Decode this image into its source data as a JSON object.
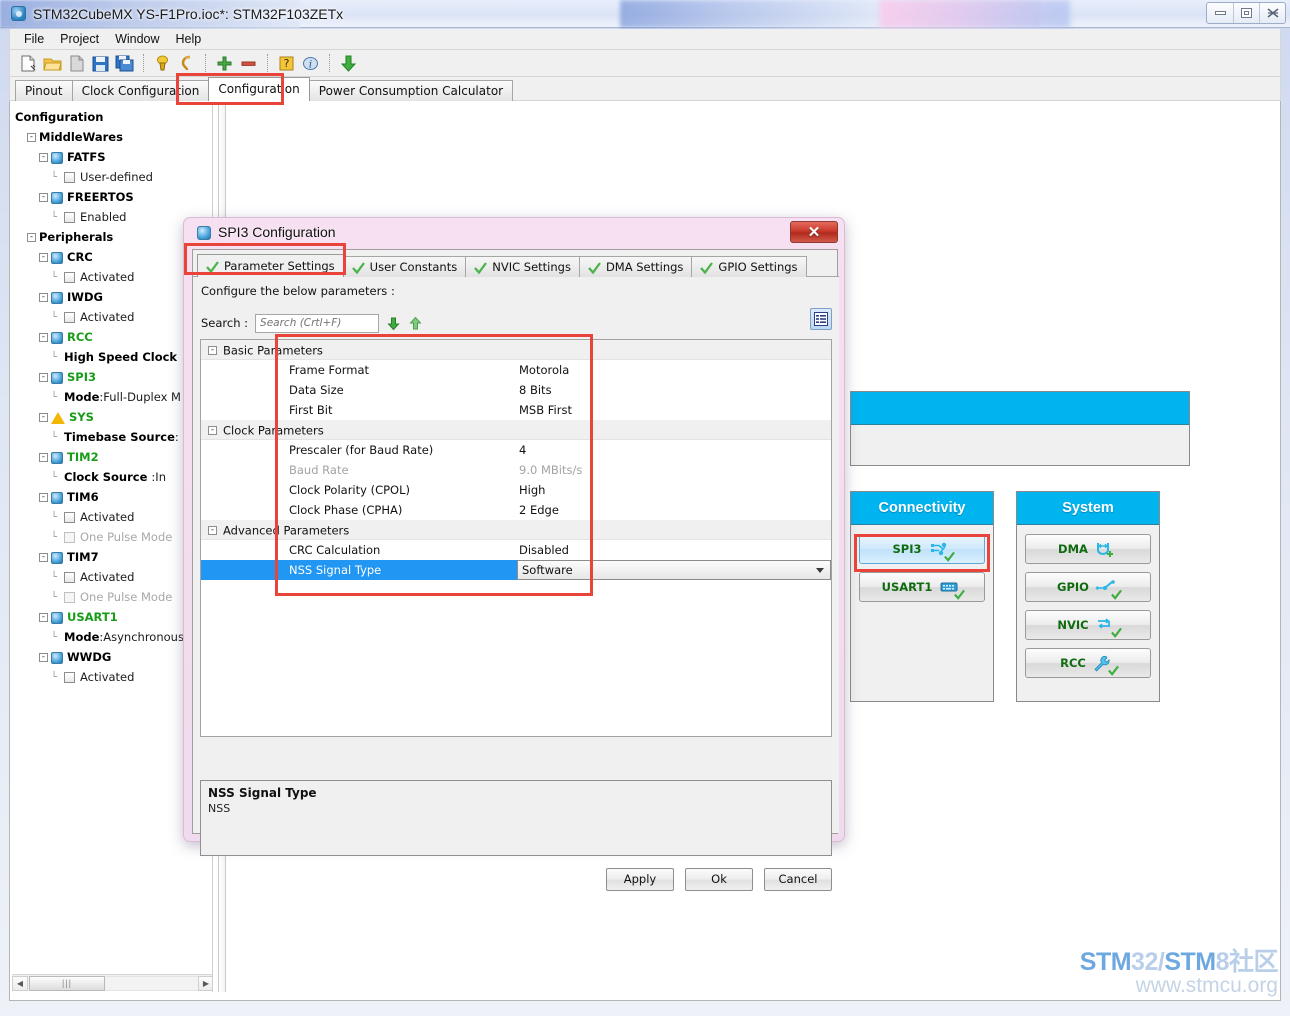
{
  "window": {
    "title": "STM32CubeMX YS-F1Pro.ioc*: STM32F103ZETx",
    "icon": "cubemx-icon",
    "buttons": {
      "minimize": "minimize-icon",
      "maximize": "maximize-icon",
      "close": "close-icon"
    }
  },
  "menubar": {
    "items": [
      "File",
      "Project",
      "Window",
      "Help"
    ]
  },
  "toolbar": {
    "items": [
      {
        "name": "new-project-icon"
      },
      {
        "name": "open-project-icon"
      },
      {
        "name": "save-as-icon"
      },
      {
        "name": "save-icon"
      },
      {
        "name": "save-all-icon"
      },
      {
        "name": "generate-report-icon"
      },
      {
        "name": "generate-code-icon"
      },
      {
        "name": "zoom-in-icon"
      },
      {
        "name": "zoom-out-icon"
      },
      {
        "name": "help-icon"
      },
      {
        "name": "about-icon"
      },
      {
        "name": "download-icon"
      }
    ]
  },
  "tabs": {
    "items": [
      "Pinout",
      "Clock Configuration",
      "Configuration",
      "Power Consumption Calculator"
    ],
    "selected": "Configuration"
  },
  "sidebar": {
    "root_label": "Configuration",
    "nodes": [
      {
        "label": "MiddleWares",
        "type": "group",
        "indent": 1,
        "expander": "-"
      },
      {
        "label": "FATFS",
        "type": "peripheral",
        "indent": 2,
        "expander": "-",
        "state": "normal"
      },
      {
        "label": "User-defined",
        "type": "checkbox",
        "indent": 3,
        "checked": false
      },
      {
        "label": "FREERTOS",
        "type": "peripheral",
        "indent": 2,
        "expander": "-",
        "state": "normal"
      },
      {
        "label": "Enabled",
        "type": "checkbox",
        "indent": 3,
        "checked": false
      },
      {
        "label": "Peripherals",
        "type": "group",
        "indent": 1,
        "expander": "-"
      },
      {
        "label": "CRC",
        "type": "peripheral",
        "indent": 2,
        "expander": "-",
        "state": "normal"
      },
      {
        "label": "Activated",
        "type": "checkbox",
        "indent": 3,
        "checked": false
      },
      {
        "label": "IWDG",
        "type": "peripheral",
        "indent": 2,
        "expander": "-",
        "state": "normal"
      },
      {
        "label": "Activated",
        "type": "checkbox",
        "indent": 3,
        "checked": false
      },
      {
        "label": "RCC",
        "type": "peripheral",
        "indent": 2,
        "expander": "-",
        "state": "active"
      },
      {
        "label": "High Speed Clock",
        "type": "leaf",
        "indent": 3
      },
      {
        "label": "SPI3",
        "type": "peripheral",
        "indent": 2,
        "expander": "-",
        "state": "active"
      },
      {
        "label": "Mode",
        "value": ":Full-Duplex M",
        "type": "kv",
        "indent": 3
      },
      {
        "label": "SYS",
        "type": "peripheral-warn",
        "indent": 2,
        "expander": "-",
        "state": "active"
      },
      {
        "label": "Timebase Source",
        "value": ":",
        "type": "kv",
        "indent": 3
      },
      {
        "label": "TIM2",
        "type": "peripheral",
        "indent": 2,
        "expander": "-",
        "state": "active"
      },
      {
        "label": "Clock Source ",
        "value": ":In",
        "type": "kv",
        "indent": 3
      },
      {
        "label": "TIM6",
        "type": "peripheral",
        "indent": 2,
        "expander": "-",
        "state": "normal"
      },
      {
        "label": "Activated",
        "type": "checkbox",
        "indent": 3,
        "checked": false
      },
      {
        "label": "One Pulse Mode",
        "type": "checkbox",
        "indent": 3,
        "checked": false,
        "disabled": true
      },
      {
        "label": "TIM7",
        "type": "peripheral",
        "indent": 2,
        "expander": "-",
        "state": "normal"
      },
      {
        "label": "Activated",
        "type": "checkbox",
        "indent": 3,
        "checked": false
      },
      {
        "label": "One Pulse Mode",
        "type": "checkbox",
        "indent": 3,
        "checked": false,
        "disabled": true
      },
      {
        "label": "USART1",
        "type": "peripheral",
        "indent": 2,
        "expander": "-",
        "state": "active"
      },
      {
        "label": "Mode",
        "value": ":Asynchronous",
        "type": "kv",
        "indent": 3
      },
      {
        "label": "WWDG",
        "type": "peripheral",
        "indent": 2,
        "expander": "-",
        "state": "normal"
      },
      {
        "label": "Activated",
        "type": "checkbox",
        "indent": 3,
        "checked": false
      }
    ],
    "scrollbar": {
      "left_arrow": "◀",
      "right_arrow": "▶",
      "grip": "|||"
    }
  },
  "canvas": {
    "panels": [
      {
        "title": "Connectivity",
        "buttons": [
          {
            "label": "SPI3",
            "icon": "spi-icon",
            "selected": true,
            "checked": true
          },
          {
            "label": "USART1",
            "icon": "usart-icon",
            "selected": false,
            "checked": true
          }
        ]
      },
      {
        "title": "System",
        "buttons": [
          {
            "label": "DMA",
            "icon": "dma-icon",
            "selected": false,
            "checked": false,
            "plus": true
          },
          {
            "label": "GPIO",
            "icon": "gpio-icon",
            "selected": false,
            "checked": true
          },
          {
            "label": "NVIC",
            "icon": "nvic-icon",
            "selected": false,
            "checked": true
          },
          {
            "label": "RCC",
            "icon": "rcc-wrench-icon",
            "selected": false,
            "checked": true
          }
        ]
      }
    ]
  },
  "dialog": {
    "title": "SPI3 Configuration",
    "icon": "cubemx-icon",
    "close_label": "✕",
    "tabs": [
      {
        "label": "Parameter Settings",
        "selected": true,
        "icon": "green-check-icon"
      },
      {
        "label": "User Constants",
        "selected": false,
        "icon": "green-check-icon"
      },
      {
        "label": "NVIC Settings",
        "selected": false,
        "icon": "green-check-icon"
      },
      {
        "label": "DMA Settings",
        "selected": false,
        "icon": "green-check-icon"
      },
      {
        "label": "GPIO Settings",
        "selected": false,
        "icon": "green-check-icon"
      }
    ],
    "configure_label": "Configure the below parameters :",
    "search": {
      "label": "Search :",
      "placeholder": "Search (Crtl+F)",
      "value": "",
      "next_icon": "arrow-down-icon",
      "prev_icon": "arrow-up-icon"
    },
    "listview_icon": "list-view-icon",
    "table": {
      "rows": [
        {
          "kind": "group",
          "name": "Basic Parameters",
          "expander": "-"
        },
        {
          "kind": "item",
          "name": "Frame Format",
          "value": "Motorola"
        },
        {
          "kind": "item",
          "name": "Data Size",
          "value": "8 Bits"
        },
        {
          "kind": "item",
          "name": "First Bit",
          "value": "MSB First"
        },
        {
          "kind": "group",
          "name": "Clock Parameters",
          "expander": "-"
        },
        {
          "kind": "item",
          "name": "Prescaler (for Baud Rate)",
          "value": "4"
        },
        {
          "kind": "item",
          "name": "Baud Rate",
          "value": "9.0 MBits/s",
          "disabled": true
        },
        {
          "kind": "item",
          "name": "Clock Polarity (CPOL)",
          "value": "High"
        },
        {
          "kind": "item",
          "name": "Clock Phase (CPHA)",
          "value": "2 Edge"
        },
        {
          "kind": "group",
          "name": "Advanced Parameters",
          "expander": "-"
        },
        {
          "kind": "item",
          "name": "CRC Calculation",
          "value": "Disabled"
        },
        {
          "kind": "combo",
          "name": "NSS Signal Type",
          "value": "Software",
          "selected": true
        }
      ]
    },
    "description": {
      "title": "NSS Signal Type",
      "text": "NSS"
    },
    "buttons": [
      {
        "label": "Apply",
        "name": "apply-button"
      },
      {
        "label": "Ok",
        "name": "ok-button"
      },
      {
        "label": "Cancel",
        "name": "cancel-button"
      }
    ]
  },
  "watermark": {
    "line1_a": "STM",
    "line1_b": "32/",
    "line1_c": "STM",
    "line1_d": "8社区",
    "line2": "www.stmcu.org"
  },
  "colors": {
    "accent_blue": "#00b4f0",
    "selection_blue": "#2196f3",
    "highlight_red": "#e8443a",
    "active_green": "#1a9c1a"
  }
}
